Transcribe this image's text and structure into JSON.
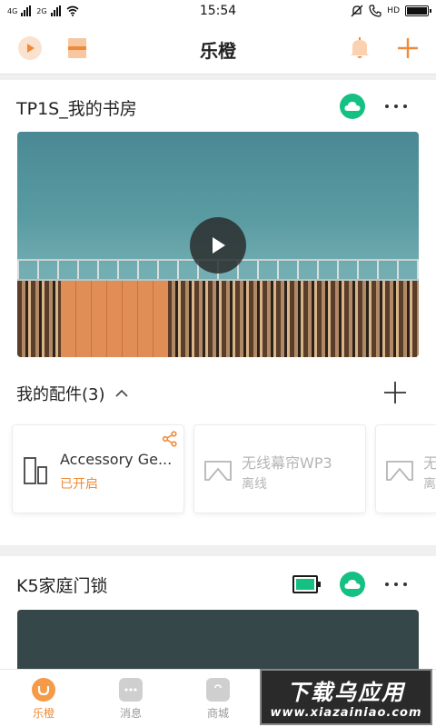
{
  "status_bar": {
    "left_labels": [
      "4G",
      "2G"
    ],
    "time": "15:54",
    "right_label": "HD"
  },
  "header": {
    "title": "乐橙"
  },
  "devices": [
    {
      "name": "TP1S_我的书房",
      "accessories_label": "我的配件(3)",
      "accessories": [
        {
          "name": "Accessory Ge...",
          "status": "已开启"
        },
        {
          "name": "无线幕帘WP3",
          "status": "离线"
        },
        {
          "name": "无",
          "status": "离"
        }
      ]
    },
    {
      "name": "K5家庭门锁"
    }
  ],
  "bottom_nav": [
    {
      "label": "乐橙"
    },
    {
      "label": "消息"
    },
    {
      "label": "商城"
    }
  ],
  "watermark": {
    "main": "下载乌应用",
    "sub": "www.xiazainiao.com"
  },
  "colors": {
    "accent_orange": "#f08a36",
    "cloud_green": "#15c083",
    "offline_gray": "#b5b5b5"
  }
}
